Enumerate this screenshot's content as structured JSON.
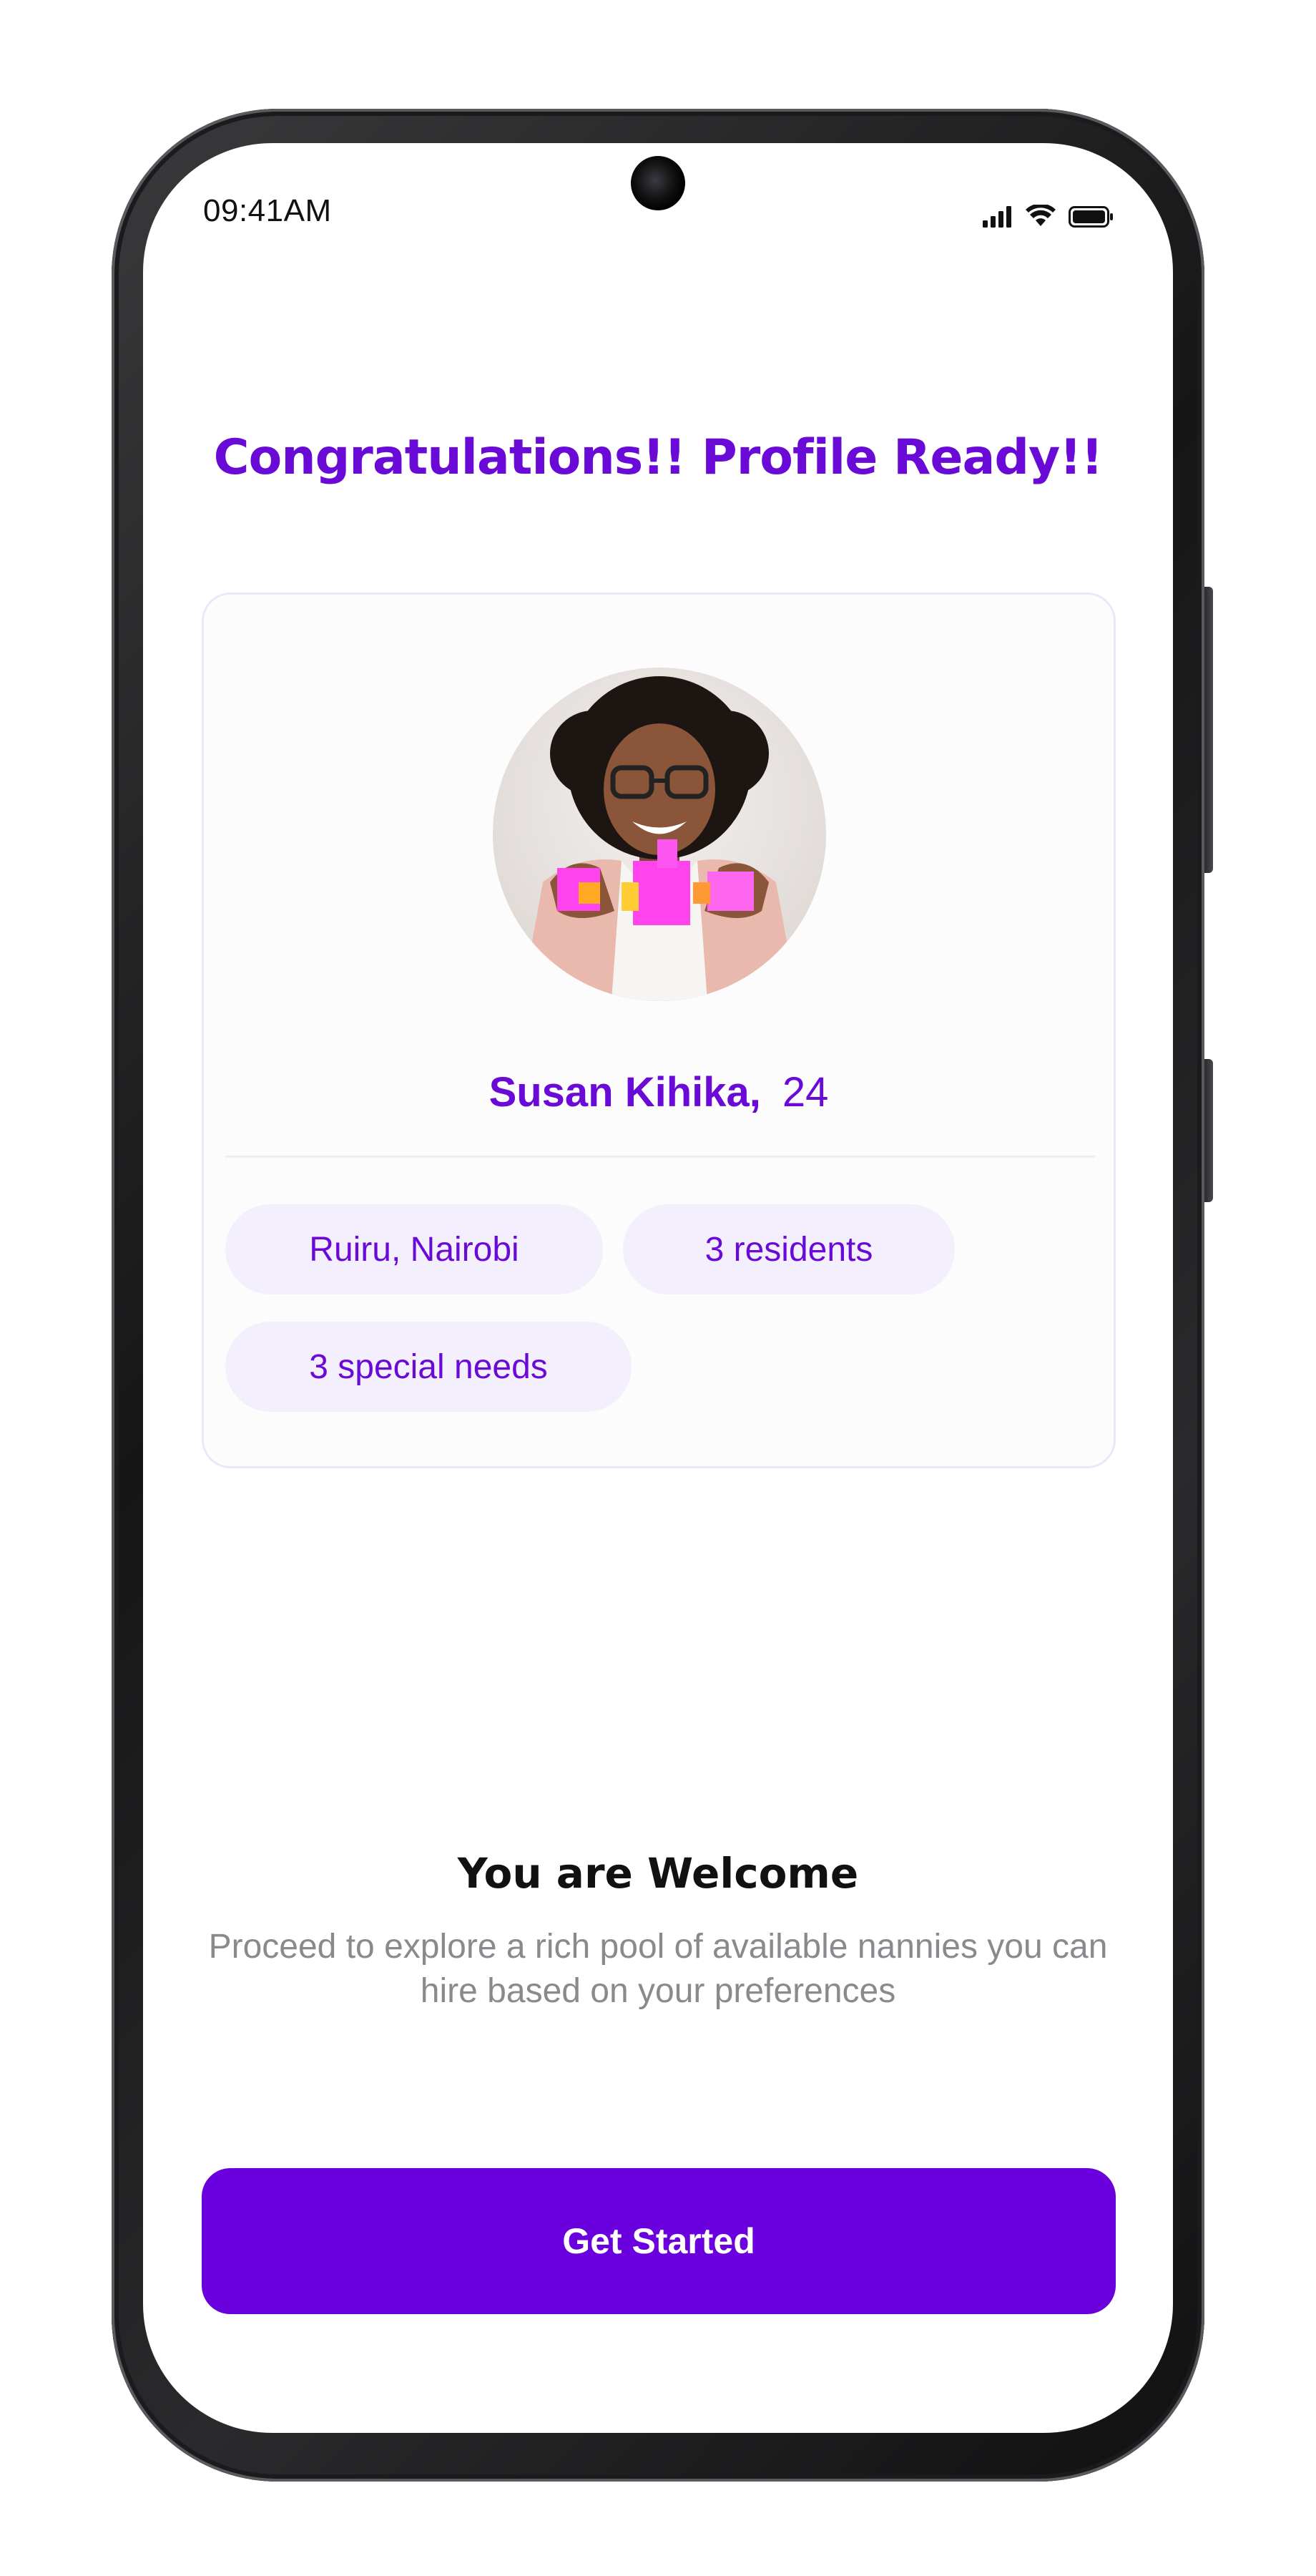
{
  "status_bar": {
    "time": "09:41AM",
    "icons": [
      "signal-icon",
      "wifi-icon",
      "battery-icon"
    ]
  },
  "header": {
    "title": "Congratulations!! Profile Ready!!"
  },
  "profile_card": {
    "avatar_icon": "profile-photo",
    "name": "Susan Kihika,",
    "age": "24",
    "chips": [
      {
        "label": "Ruiru, Nairobi"
      },
      {
        "label": "3 residents"
      },
      {
        "label": "3 special needs"
      }
    ]
  },
  "welcome": {
    "title": "You are Welcome",
    "text": "Proceed to explore a rich pool of available nannies you can hire based on your preferences"
  },
  "cta": {
    "label": "Get Started"
  },
  "colors": {
    "accent": "#6A0AD6",
    "button": "#6A00DD",
    "chip_bg": "#F4EFFD",
    "muted_text": "#8A8A8E"
  }
}
